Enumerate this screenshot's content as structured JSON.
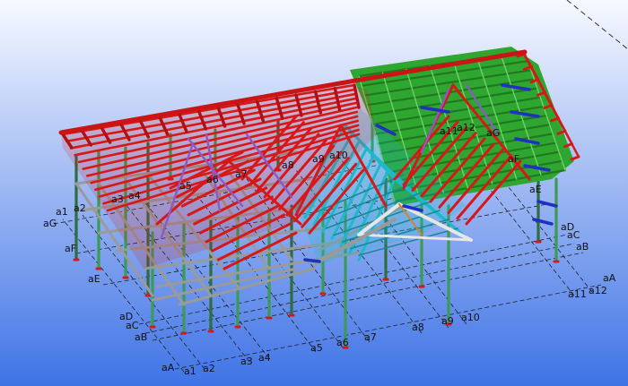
{
  "viewport": {
    "background_top": "#f7f9ff",
    "background_bottom": "#3f73e6"
  },
  "grid_labels": {
    "a1_left": "a1",
    "a2_left": "a2",
    "aG_left": "aG",
    "aF_left": "aF",
    "aE_left": "aE",
    "aD_left": "aD",
    "aC_left": "aC",
    "aB_left": "aB",
    "aA_bottom": "aA",
    "a1_bottom": "a1",
    "a2_bottom": "a2",
    "a3_bottom": "a3",
    "a4_bottom": "a4",
    "a5_bottom": "a5",
    "a6_bottom": "a6",
    "a7_bottom": "a7",
    "a8_bottom": "a8",
    "a9_bottom": "a9",
    "a10_bottom": "a10",
    "a11_right": "a11",
    "a12_right": "a12",
    "aA_right": "aA",
    "aB_right": "aB",
    "aC_right": "aC",
    "aD_right": "aD",
    "aE_right": "aE",
    "aF_right": "aF",
    "aG_right": "aG",
    "a3_frame": "a3",
    "a4_frame": "a4",
    "a5_frame": "a5",
    "a6_frame": "a6",
    "a7_frame": "a7",
    "a8_frame": "a8",
    "a9_frame": "a9",
    "a10_frame": "a10",
    "a11_frame": "a11",
    "a12_frame": "a12"
  },
  "colors": {
    "red_beam": "#d81818",
    "green_beam": "#2fa62f",
    "cyan_beam": "#1fb7c9",
    "purple_beam": "#8a5bc7",
    "grey_beam": "#9a9a9a",
    "column": "#3c9a55",
    "dark_column": "#2e6d3e",
    "blue_brace": "#2030c0",
    "orange": "#d9822b",
    "grid_line": "#333333"
  }
}
